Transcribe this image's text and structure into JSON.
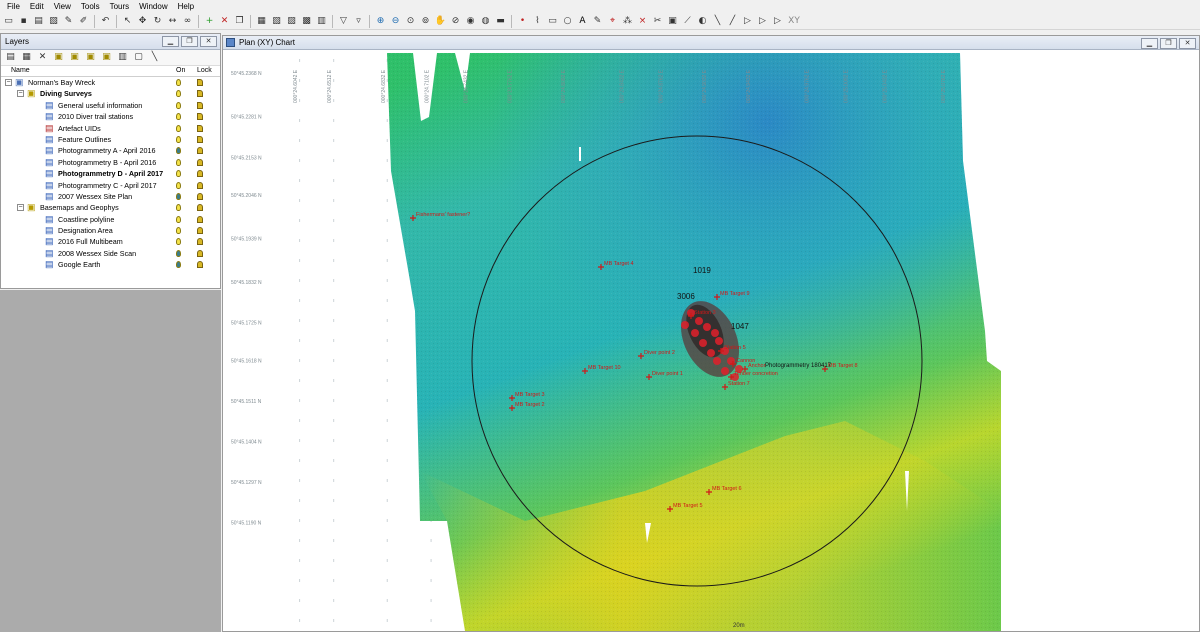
{
  "menu": [
    "File",
    "Edit",
    "View",
    "Tools",
    "Tours",
    "Window",
    "Help"
  ],
  "toolbar_icons": [
    "open-folder-icon",
    "save-icon",
    "print-icon",
    "new-layer-icon",
    "brush-icon",
    "edit-icon",
    "undo-icon",
    "select-arrow-icon",
    "move-icon",
    "rotate-icon",
    "measure-icon",
    "binoculars-icon",
    "add-icon",
    "delete-icon",
    "copy-icon",
    "chart-icon",
    "plan-chart-icon",
    "section-chart-icon",
    "profile-chart-icon",
    "window-arrange-icon",
    "filter-icon",
    "filter-outline-icon",
    "zoom-in-icon",
    "zoom-out-icon",
    "zoom-window-icon",
    "zoom-extent-icon",
    "pan-icon",
    "zoom-previous-icon",
    "zoom-layer-icon",
    "globe-icon",
    "scale-bar-icon",
    "point-icon",
    "polyline-icon",
    "rectangle-icon",
    "circle-icon",
    "text-icon",
    "pencil-icon",
    "target-icon",
    "link-icon",
    "cross-icon",
    "cut-icon",
    "box-icon",
    "measure-dropdown-icon",
    "sphere-icon",
    "line-draw-icon",
    "line-draw2-icon",
    "flag-icon",
    "flag2-icon",
    "flag3-icon",
    "xy-icon"
  ],
  "toolbar_xy": "XY",
  "layers_panel": {
    "title": "Layers",
    "columns": {
      "name": "Name",
      "on": "On",
      "lock": "Lock"
    },
    "items": [
      {
        "label": "Norman's Bay Wreck",
        "level": 0,
        "expander": "-",
        "icon": "project-icon",
        "bold": false,
        "on_color": "#f4e34a",
        "lock": "open"
      },
      {
        "label": "Diving Surveys",
        "level": 1,
        "expander": "-",
        "icon": "group-folder-icon",
        "bold": true,
        "on_color": "#f4e34a",
        "lock": "open"
      },
      {
        "label": "General useful information",
        "level": 2,
        "expander": "",
        "icon": "layer-icon",
        "bold": false,
        "on_color": "#f4e34a",
        "lock": "open"
      },
      {
        "label": "2010 Diver trail stations",
        "level": 2,
        "expander": "",
        "icon": "layer-icon",
        "bold": false,
        "on_color": "#f4e34a",
        "lock": "open"
      },
      {
        "label": "Artefact UIDs",
        "level": 2,
        "expander": "",
        "icon": "layer-red-icon",
        "bold": false,
        "on_color": "#f4e34a",
        "lock": "open"
      },
      {
        "label": "Feature Outlines",
        "level": 2,
        "expander": "",
        "icon": "layer-icon",
        "bold": false,
        "on_color": "#f4e34a",
        "lock": "open"
      },
      {
        "label": "Photogrammetry A - April 2016",
        "level": 2,
        "expander": "",
        "icon": "layer-icon",
        "bold": false,
        "on_color": "#3a7d8c",
        "lock": "closed"
      },
      {
        "label": "Photogrammetry B - April 2016",
        "level": 2,
        "expander": "",
        "icon": "layer-icon",
        "bold": false,
        "on_color": "#f4e34a",
        "lock": "closed"
      },
      {
        "label": "Photogrammetry D - April 2017",
        "level": 2,
        "expander": "",
        "icon": "layer-icon",
        "bold": true,
        "on_color": "#f4e34a",
        "lock": "closed"
      },
      {
        "label": "Photogrammetry C - April 2017",
        "level": 2,
        "expander": "",
        "icon": "layer-icon",
        "bold": false,
        "on_color": "#f4e34a",
        "lock": "closed"
      },
      {
        "label": "2007 Wessex Site Plan",
        "level": 2,
        "expander": "",
        "icon": "layer-icon",
        "bold": false,
        "on_color": "#3a7d8c",
        "lock": "closed"
      },
      {
        "label": "Basemaps and Geophys",
        "level": 1,
        "expander": "-",
        "icon": "group-folder-icon",
        "bold": false,
        "on_color": "#f4e34a",
        "lock": "closed"
      },
      {
        "label": "Coastline polyline",
        "level": 2,
        "expander": "",
        "icon": "layer-icon",
        "bold": false,
        "on_color": "#f4e34a",
        "lock": "closed"
      },
      {
        "label": "Designation Area",
        "level": 2,
        "expander": "",
        "icon": "layer-icon",
        "bold": false,
        "on_color": "#f4e34a",
        "lock": "closed"
      },
      {
        "label": "2016 Full Multibeam",
        "level": 2,
        "expander": "",
        "icon": "layer-icon",
        "bold": false,
        "on_color": "#f4e34a",
        "lock": "closed"
      },
      {
        "label": "2008 Wessex Side Scan",
        "level": 2,
        "expander": "",
        "icon": "layer-icon",
        "bold": false,
        "on_color": "#3a7d8c",
        "lock": "closed"
      },
      {
        "label": "Google Earth",
        "level": 2,
        "expander": "",
        "icon": "layer-icon",
        "bold": false,
        "on_color": "#3a7d8c",
        "lock": "closed"
      }
    ]
  },
  "chart_window": {
    "title": "Plan (XY) Chart",
    "x_ticks": [
      "000°24.6042 E",
      "000°24.6512 E",
      "000°24.6832 E",
      "000°24.7102 E",
      "000°24.7432 E",
      "000°24.7762 E",
      "000°24.8092 E",
      "000°24.8432 E",
      "000°24.8762 E",
      "000°24.9032 E",
      "000°24.9432 E",
      "000°24.9762 E",
      "000°25.0092 E",
      "000°25.0432 E",
      "000°25.0762 E"
    ],
    "y_ticks": [
      "50°45.2368 N",
      "50°45.2281 N",
      "50°45.2153 N",
      "50°45.2046 N",
      "50°45.1939 N",
      "50°45.1832 N",
      "50°45.1725 N",
      "50°45.1618 N",
      "50°45.1511 N",
      "50°45.1404 N",
      "50°45.1297 N",
      "50°45.1190 N"
    ],
    "scale_label": "20m",
    "black_labels": [
      "1019",
      "3006",
      "1047",
      "Photogrammetry 180417"
    ],
    "targets": [
      {
        "label": "Fishermans' fastener?"
      },
      {
        "label": "MB Target 4"
      },
      {
        "label": "MB Target 9"
      },
      {
        "label": "MB Target 10"
      },
      {
        "label": "MB Target 8"
      },
      {
        "label": "MB Target 3"
      },
      {
        "label": "MB Target 2"
      },
      {
        "label": "MB Target 6"
      },
      {
        "label": "MB Target 5"
      },
      {
        "label": "Diver point 2"
      },
      {
        "label": "Diver point 1"
      },
      {
        "label": "Station 3"
      },
      {
        "label": "Station 5"
      },
      {
        "label": "Station 7"
      },
      {
        "label": "Cannon"
      },
      {
        "label": "Anchor"
      },
      {
        "label": "Timber concretion"
      }
    ]
  }
}
